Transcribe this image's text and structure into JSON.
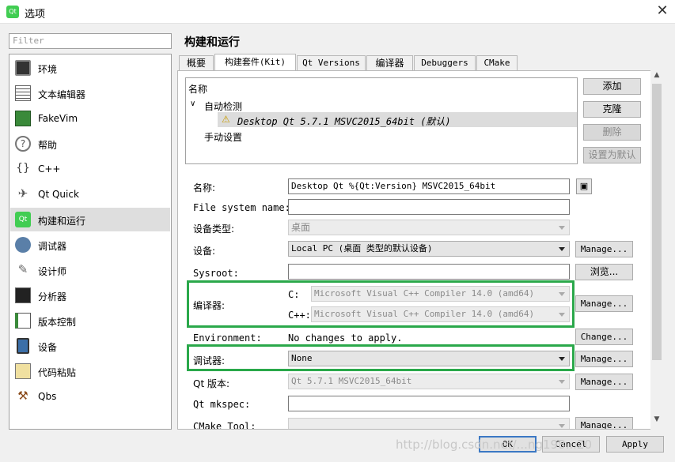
{
  "window": {
    "title": "选项",
    "app_icon": "Qt"
  },
  "filter": {
    "placeholder": "Filter"
  },
  "sidebar": {
    "items": [
      {
        "label": "环境",
        "icon": "monitor-icon"
      },
      {
        "label": "文本编辑器",
        "icon": "text-editor-icon"
      },
      {
        "label": "FakeVim",
        "icon": "fakevim-icon"
      },
      {
        "label": "帮助",
        "icon": "help-icon"
      },
      {
        "label": "C++",
        "icon": "cpp-icon"
      },
      {
        "label": "Qt Quick",
        "icon": "qtquick-icon"
      },
      {
        "label": "构建和运行",
        "icon": "build-run-icon",
        "selected": true
      },
      {
        "label": "调试器",
        "icon": "debugger-icon"
      },
      {
        "label": "设计师",
        "icon": "designer-icon"
      },
      {
        "label": "分析器",
        "icon": "analyzer-icon"
      },
      {
        "label": "版本控制",
        "icon": "version-control-icon"
      },
      {
        "label": "设备",
        "icon": "devices-icon"
      },
      {
        "label": "代码粘贴",
        "icon": "code-paste-icon"
      },
      {
        "label": "Qbs",
        "icon": "qbs-icon"
      }
    ]
  },
  "page_title": "构建和运行",
  "tabs": [
    {
      "label": "概要"
    },
    {
      "label": "构建套件(Kit)",
      "active": true
    },
    {
      "label": "Qt Versions"
    },
    {
      "label": "编译器"
    },
    {
      "label": "Debuggers"
    },
    {
      "label": "CMake"
    }
  ],
  "kit_tree": {
    "header": "名称",
    "auto_group": "自动检测",
    "auto_kit": "Desktop Qt 5.7.1 MSVC2015_64bit (默认)",
    "manual_group": "手动设置"
  },
  "kit_buttons": {
    "add": "添加",
    "clone": "克隆",
    "remove": "删除",
    "make_default": "设置为默认"
  },
  "form": {
    "name_label": "名称:",
    "name_value": "Desktop Qt %{Qt:Version} MSVC2015_64bit",
    "fs_name_label": "File system name:",
    "fs_name_value": "",
    "device_type_label": "设备类型:",
    "device_type_value": "桌面",
    "device_label": "设备:",
    "device_value": "Local PC (桌面 类型的默认设备)",
    "sysroot_label": "Sysroot:",
    "sysroot_value": "",
    "compiler_label": "编译器:",
    "c_label": "C:",
    "c_value": "Microsoft Visual C++ Compiler 14.0 (amd64)",
    "cpp_label": "C++:",
    "cpp_value": "Microsoft Visual C++ Compiler 14.0 (amd64)",
    "env_label": "Environment:",
    "env_value": "No changes to apply.",
    "debugger_label": "调试器:",
    "debugger_value": "None",
    "qt_version_label": "Qt 版本:",
    "qt_version_value": "Qt 5.7.1 MSVC2015_64bit",
    "mkspec_label": "Qt mkspec:",
    "mkspec_value": "",
    "cmake_label": "CMake Tool:",
    "manage": "Manage...",
    "browse": "浏览...",
    "change": "Change..."
  },
  "footer": {
    "ok": "OK",
    "cancel": "Cancel",
    "apply": "Apply"
  },
  "watermark": "http://blog.csdn.net/...ng198...20",
  "colors": {
    "highlight": "#2aa84a",
    "selection": "#dedede"
  }
}
